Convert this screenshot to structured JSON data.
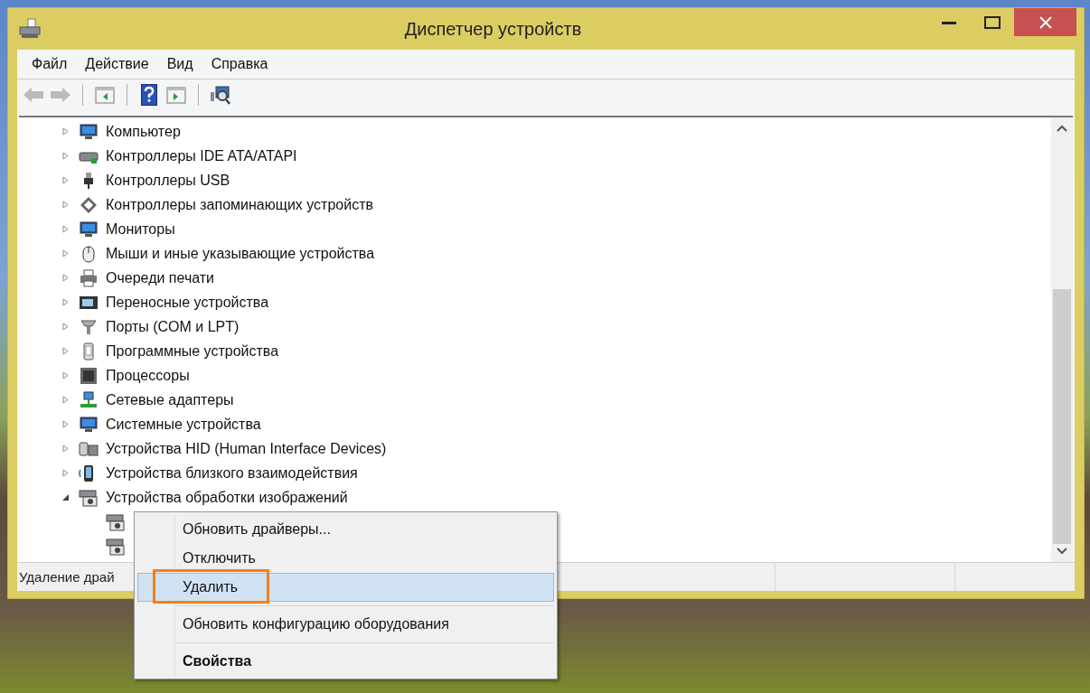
{
  "window": {
    "title": "Диспетчер устройств"
  },
  "menu_bar": [
    "Файл",
    "Действие",
    "Вид",
    "Справка"
  ],
  "toolbar": [
    {
      "kind": "back",
      "disabled": true
    },
    {
      "kind": "forward",
      "disabled": true
    },
    {
      "kind": "separator"
    },
    {
      "kind": "console-tree"
    },
    {
      "kind": "separator"
    },
    {
      "kind": "help"
    },
    {
      "kind": "action-pane"
    },
    {
      "kind": "separator"
    },
    {
      "kind": "scan"
    }
  ],
  "tree": [
    {
      "label": "Компьютер",
      "kind": "computer",
      "expanded": false
    },
    {
      "label": "Контроллеры IDE ATA/ATAPI",
      "kind": "drive",
      "expanded": false
    },
    {
      "label": "Контроллеры USB",
      "kind": "usb",
      "expanded": false
    },
    {
      "label": "Контроллеры запоминающих устройств",
      "kind": "storage",
      "expanded": false
    },
    {
      "label": "Мониторы",
      "kind": "monitor",
      "expanded": false
    },
    {
      "label": "Мыши и иные указывающие устройства",
      "kind": "mouse",
      "expanded": false
    },
    {
      "label": "Очереди печати",
      "kind": "printer",
      "expanded": false
    },
    {
      "label": "Переносные устройства",
      "kind": "portable",
      "expanded": false
    },
    {
      "label": "Порты (COM и LPT)",
      "kind": "port",
      "expanded": false
    },
    {
      "label": "Программные устройства",
      "kind": "software",
      "expanded": false
    },
    {
      "label": "Процессоры",
      "kind": "chip",
      "expanded": false
    },
    {
      "label": "Сетевые адаптеры",
      "kind": "network",
      "expanded": false
    },
    {
      "label": "Системные устройства",
      "kind": "computer",
      "expanded": false
    },
    {
      "label": "Устройства HID (Human Interface Devices)",
      "kind": "hid",
      "expanded": false
    },
    {
      "label": "Устройства близкого взаимодействия",
      "kind": "proximity",
      "expanded": false
    },
    {
      "label": "Устройства обработки изображений",
      "kind": "camera",
      "expanded": true,
      "children": [
        {
          "kind": "camera"
        },
        {
          "kind": "camera"
        }
      ]
    }
  ],
  "status_bar": {
    "text": "Удаление драй"
  },
  "context_menu": {
    "items": [
      {
        "kind": "command",
        "label": "Обновить драйверы...",
        "selected": false,
        "bold": false,
        "callout": false
      },
      {
        "kind": "command",
        "label": "Отключить",
        "selected": false,
        "bold": false,
        "callout": false
      },
      {
        "kind": "command",
        "label": "Удалить",
        "selected": true,
        "bold": false,
        "callout": true
      },
      {
        "kind": "separator"
      },
      {
        "kind": "command",
        "label": "Обновить конфигурацию оборудования",
        "selected": false,
        "bold": false,
        "callout": false
      },
      {
        "kind": "separator"
      },
      {
        "kind": "command",
        "label": "Свойства",
        "selected": false,
        "bold": true,
        "callout": false
      }
    ]
  }
}
